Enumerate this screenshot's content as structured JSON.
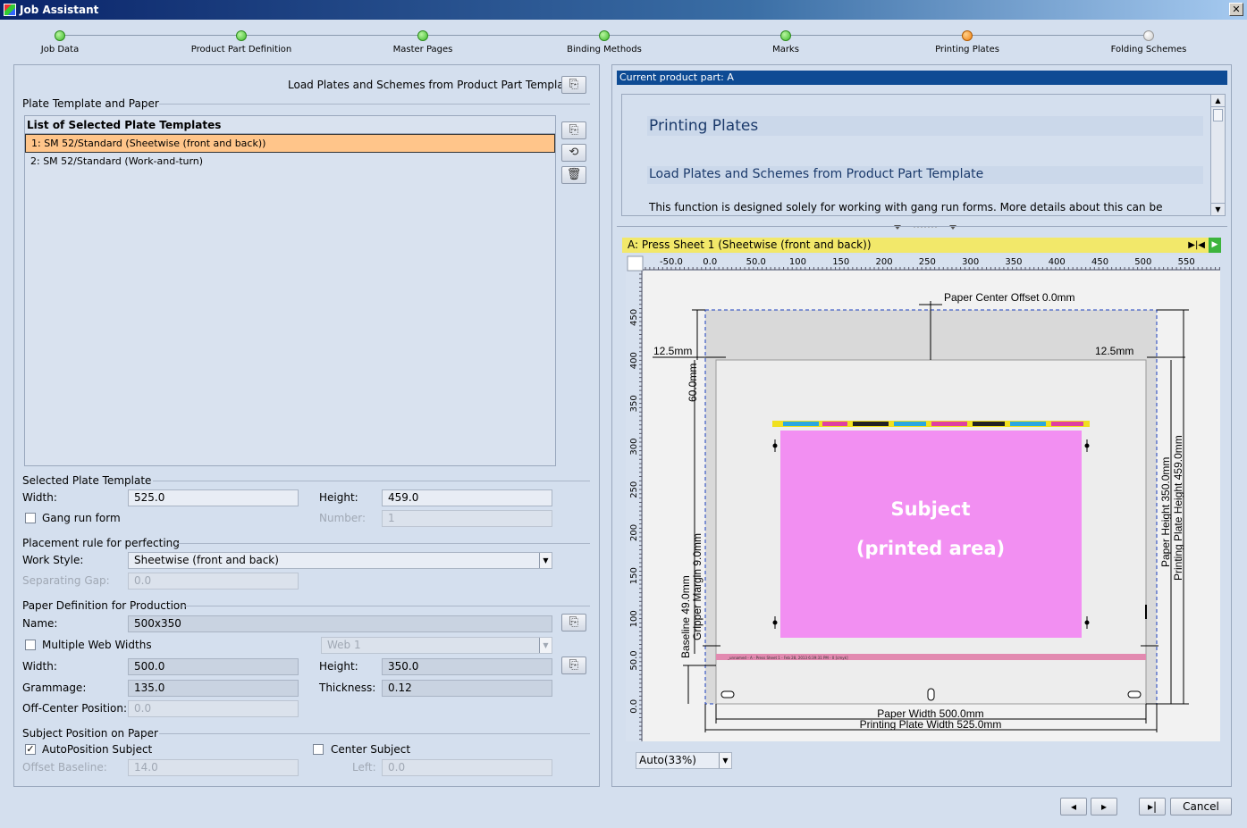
{
  "window": {
    "title": "Job Assistant"
  },
  "steps": [
    {
      "label": "Job Data"
    },
    {
      "label": "Product Part Definition"
    },
    {
      "label": "Master Pages"
    },
    {
      "label": "Binding Methods"
    },
    {
      "label": "Marks"
    },
    {
      "label": "Printing Plates"
    },
    {
      "label": "Folding Schemes"
    }
  ],
  "left": {
    "load_label": "Load Plates and Schemes from Product Part Template",
    "plate_section": "Plate Template and Paper",
    "list_header": "List of Selected Plate Templates",
    "list_items": [
      "1: SM 52/Standard (Sheetwise (front and back))",
      "2: SM 52/Standard (Work-and-turn)"
    ],
    "selected_section": "Selected Plate Template",
    "width_label": "Width:",
    "width_value": "525.0",
    "height_label": "Height:",
    "height_value": "459.0",
    "gang_label": "Gang run form",
    "number_label": "Number:",
    "number_value": "1",
    "placement_section": "Placement rule for perfecting",
    "workstyle_label": "Work Style:",
    "workstyle_value": "Sheetwise (front and back)",
    "gap_label": "Separating Gap:",
    "gap_value": "0.0",
    "paper_section": "Paper Definition for Production",
    "name_label": "Name:",
    "name_value": "500x350",
    "multiweb_label": "Multiple Web Widths",
    "web_value": "Web 1",
    "pwidth_label": "Width:",
    "pwidth_value": "500.0",
    "pheight_label": "Height:",
    "pheight_value": "350.0",
    "grammage_label": "Grammage:",
    "grammage_value": "135.0",
    "thickness_label": "Thickness:",
    "thickness_value": "0.12",
    "offcenter_label": "Off-Center Position:",
    "offcenter_value": "0.0",
    "subject_section": "Subject Position on Paper",
    "autopos_label": "AutoPosition Subject",
    "center_label": "Center Subject",
    "offsetbase_label": "Offset Baseline:",
    "offsetbase_value": "14.0",
    "left_label": "Left:",
    "left_value": "0.0"
  },
  "right": {
    "current_part": "Current product part: A",
    "help_title": "Printing Plates",
    "help_subtitle": "Load Plates and Schemes from Product Part Template",
    "help_text": "This function is designed solely for working with gang run forms. More details about this can be",
    "sheet_label": "A:  Press Sheet 1 (Sheetwise (front and back))",
    "hticks": [
      "-50.0",
      "0.0",
      "50.0",
      "100",
      "150",
      "200",
      "250",
      "300",
      "350",
      "400",
      "450",
      "500",
      "550"
    ],
    "vticks": [
      "450",
      "400",
      "350",
      "300",
      "250",
      "200",
      "150",
      "100",
      "50.0",
      "0.0"
    ],
    "dims": {
      "center_offset": "Paper Center Offset 0.0mm",
      "left_margin": "12.5mm",
      "right_margin": "12.5mm",
      "top_margin": "60.0mm",
      "paper_height": "Paper Height 350.0mm",
      "plate_height": "Printing Plate Height 459.0mm",
      "gripper": "Gripper Margin 9.0mm",
      "baseline": "Baseline 49.0mm",
      "paper_width": "Paper Width 500.0mm",
      "plate_width": "Printing Plate Width 525.0mm"
    },
    "subject_line1": "Subject",
    "subject_line2": "(printed area)",
    "slug": "_unnamed - A  - Press Sheet 1 - Feb 28, 2013 6:39:31 PM - 0 [cmyk]",
    "zoom": "Auto(33%)"
  },
  "buttons": {
    "cancel": "Cancel"
  },
  "colors": {
    "subject": "#f28ff2",
    "selection": "#ffc58a",
    "accent": "#0e4b94",
    "sheet_bar": "#f2e86a"
  }
}
